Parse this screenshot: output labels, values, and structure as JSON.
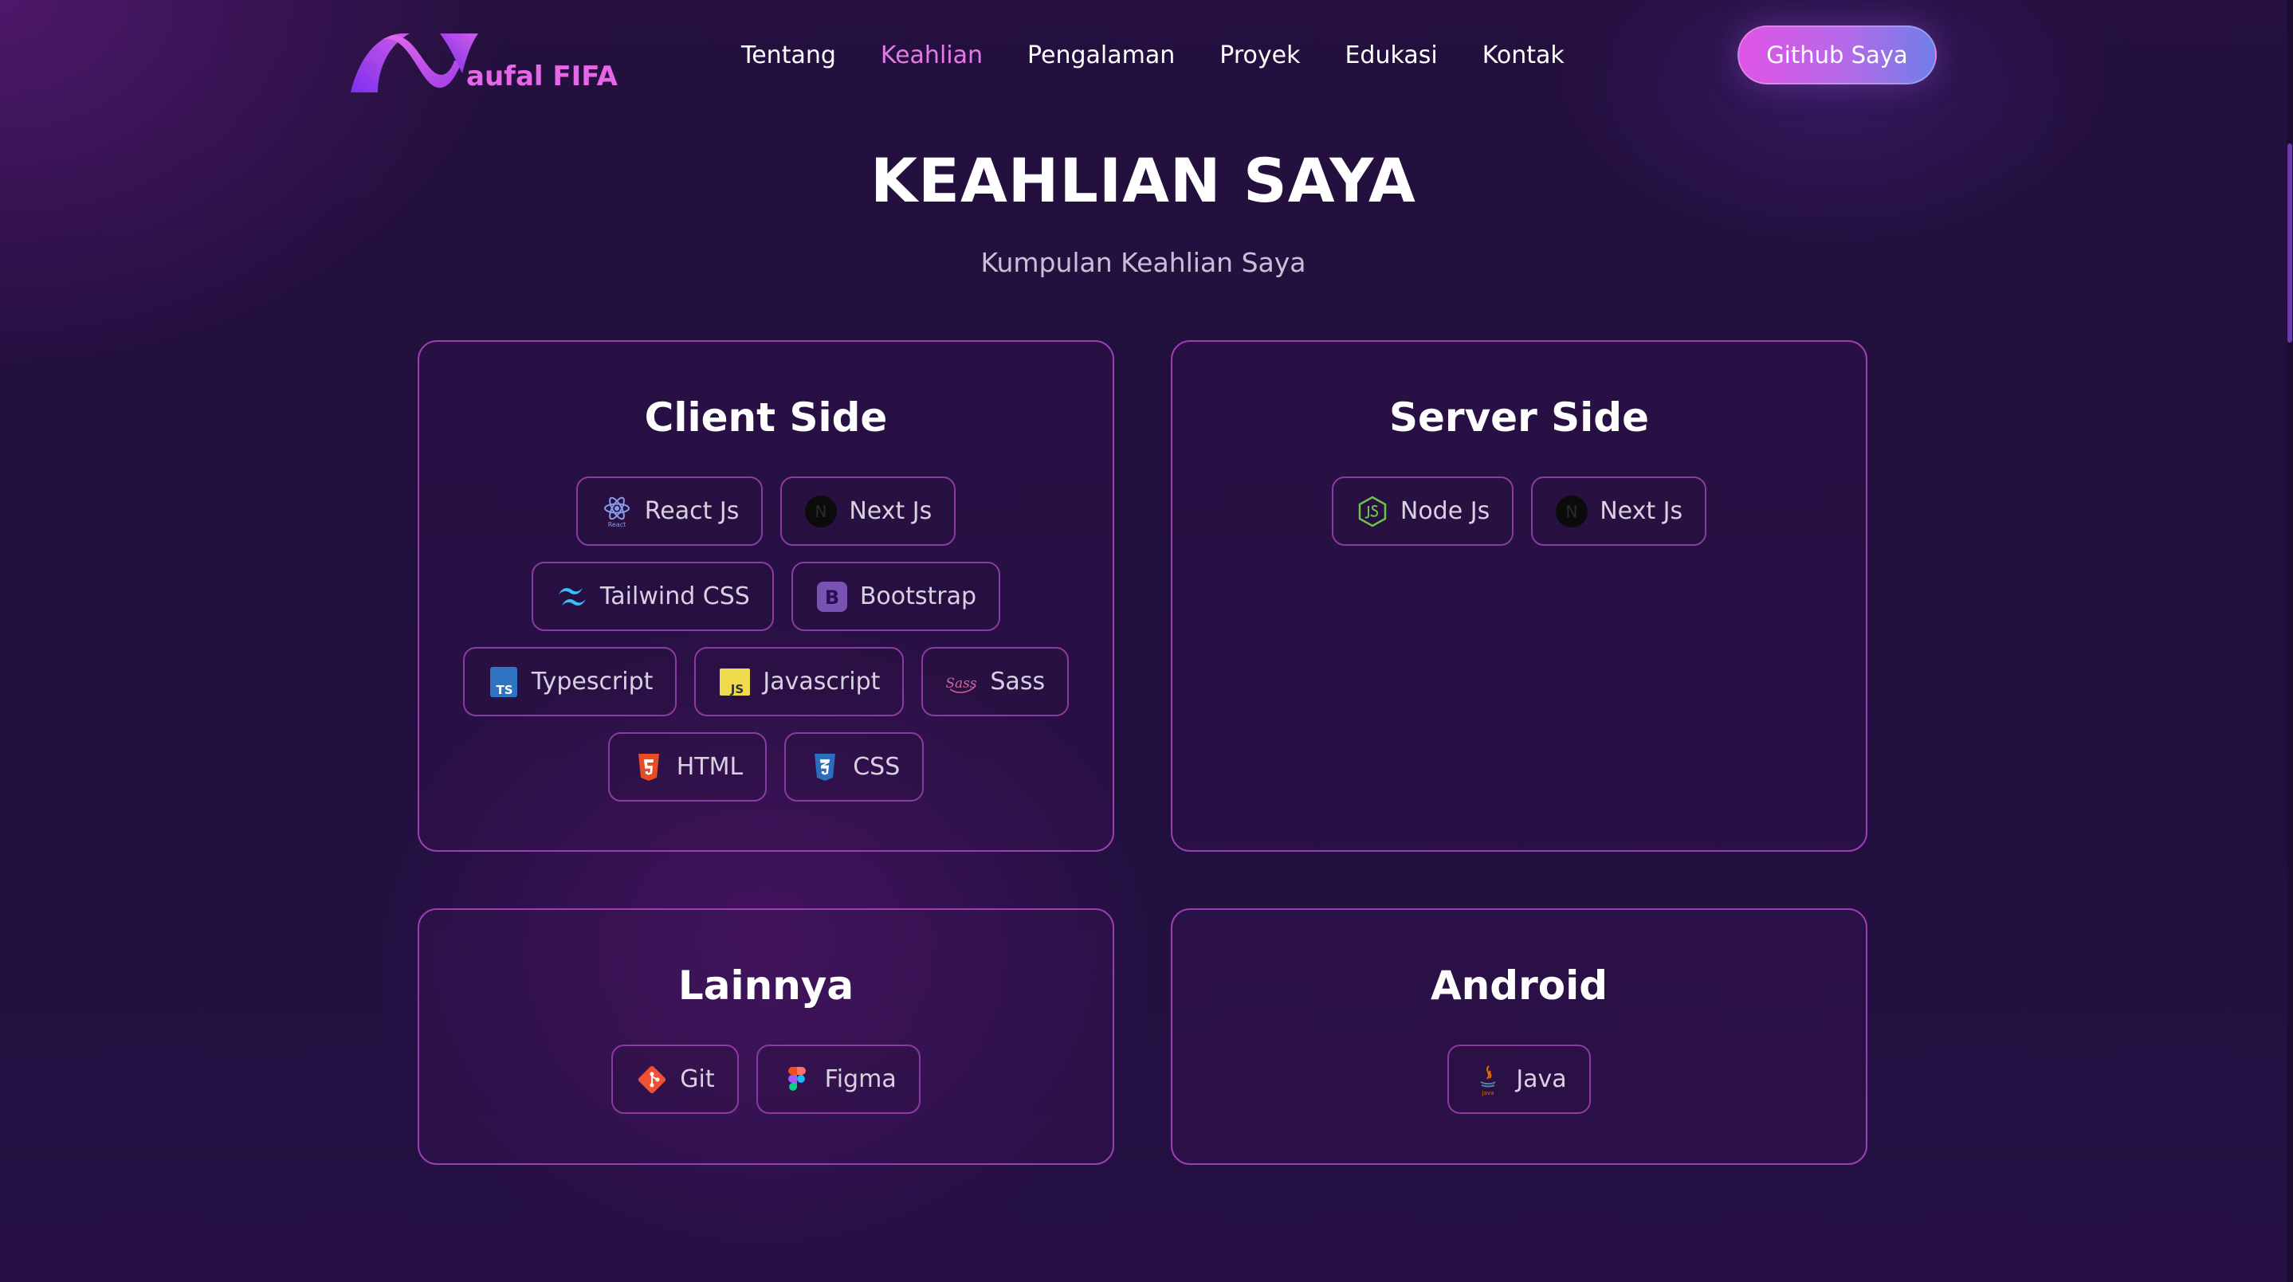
{
  "brand": {
    "logo_text": "aufal FIFA"
  },
  "nav": {
    "items": [
      {
        "label": "Tentang"
      },
      {
        "label": "Keahlian"
      },
      {
        "label": "Pengalaman"
      },
      {
        "label": "Proyek"
      },
      {
        "label": "Edukasi"
      },
      {
        "label": "Kontak"
      }
    ],
    "active": "Keahlian",
    "cta_label": "Github Saya"
  },
  "section": {
    "title": "KEAHLIAN SAYA",
    "subtitle": "Kumpulan Keahlian Saya"
  },
  "cards": {
    "client": {
      "title": "Client Side",
      "skills": [
        {
          "label": "React Js",
          "icon": "react-icon"
        },
        {
          "label": "Next Js",
          "icon": "nextjs-icon"
        },
        {
          "label": "Tailwind CSS",
          "icon": "tailwind-icon"
        },
        {
          "label": "Bootstrap",
          "icon": "bootstrap-icon"
        },
        {
          "label": "Typescript",
          "icon": "typescript-icon"
        },
        {
          "label": "Javascript",
          "icon": "javascript-icon"
        },
        {
          "label": "Sass",
          "icon": "sass-icon"
        },
        {
          "label": "HTML",
          "icon": "html5-icon"
        },
        {
          "label": "CSS",
          "icon": "css3-icon"
        }
      ]
    },
    "server": {
      "title": "Server Side",
      "skills": [
        {
          "label": "Node Js",
          "icon": "nodejs-icon"
        },
        {
          "label": "Next Js",
          "icon": "nextjs-icon"
        }
      ]
    },
    "other": {
      "title": "Lainnya",
      "skills": [
        {
          "label": "Git",
          "icon": "git-icon"
        },
        {
          "label": "Figma",
          "icon": "figma-icon"
        }
      ]
    },
    "android": {
      "title": "Android",
      "skills": [
        {
          "label": "Java",
          "icon": "java-icon"
        }
      ]
    }
  },
  "icon_text": {
    "react_caption": "React",
    "next_letter": "N",
    "bootstrap_letter": "B",
    "typescript_letters": "TS",
    "javascript_letters": "JS",
    "sass_script": "Sass",
    "java_caption": "Java"
  },
  "colors": {
    "accent": "#e47ae8",
    "card_border": "#9a3fb1",
    "chip_border": "#8c3aa3",
    "cta_gradient_start": "#e054e6",
    "cta_gradient_end": "#6f7ee8"
  }
}
